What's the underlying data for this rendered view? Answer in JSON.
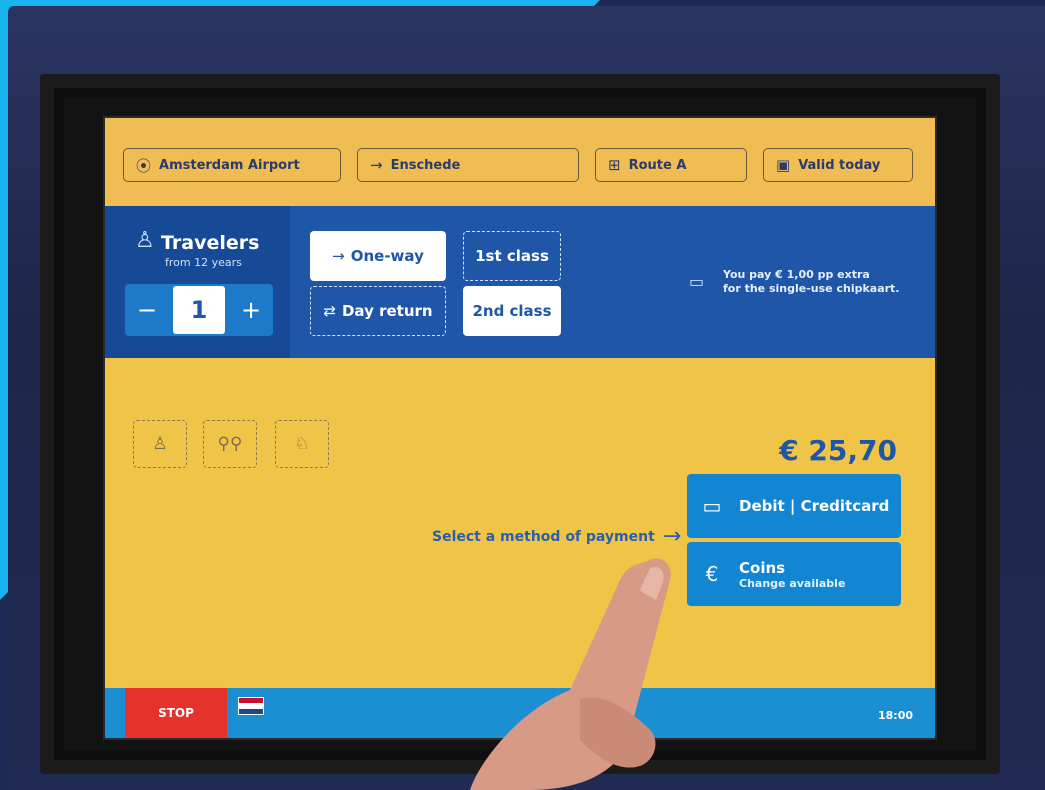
{
  "header": {
    "from": "Amsterdam Airport",
    "to": "Enschede",
    "route": "Route A",
    "validity": "Valid today"
  },
  "travelers": {
    "title": "Travelers",
    "subtitle": "from 12 years",
    "minus": "−",
    "count": "1",
    "plus": "+"
  },
  "trip_type": {
    "one_way": "One-way",
    "day_return": "Day return"
  },
  "class": {
    "first": "1st class",
    "second": "2nd class"
  },
  "info": {
    "line1": "You pay € 1,00 pp extra",
    "line2": "for the single-use chipkaart."
  },
  "price": "€ 25,70",
  "payment": {
    "prompt": "Select a method of payment",
    "card": "Debit | Creditcard",
    "coins": "Coins",
    "coins_sub": "Change available"
  },
  "footer": {
    "stop": "STOP",
    "time": "18:00"
  },
  "colors": {
    "screen_yellow": "#f0c547",
    "header_orange": "#f0bd54",
    "panel_blue": "#1f56a8",
    "pay_blue": "#1286d2",
    "stop_red": "#e5322d"
  }
}
